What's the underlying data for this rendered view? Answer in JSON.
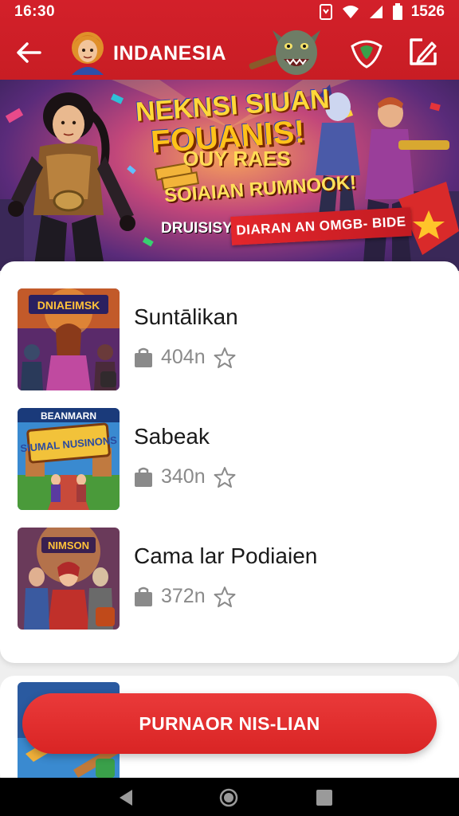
{
  "status_bar": {
    "time": "16:30",
    "battery": "1526"
  },
  "app_bar": {
    "title": "INDANESIA",
    "icons": [
      "arrow-left-icon",
      "avatar",
      "mascot",
      "shield-icon",
      "edit-icon"
    ]
  },
  "banner": {
    "line1": "NEKNSI SIUAN",
    "line2": "FOUANIS!",
    "line3": "OUY RAES",
    "line4": "SOIAIAN RUMNOOK!",
    "line5": "DRUISISY",
    "ribbon": "DIARAN AN OMGB- BIDE"
  },
  "list": {
    "items": [
      {
        "title": "Suntālikan",
        "meta": "404n",
        "thumb_text": "DNIAEIMSK"
      },
      {
        "title": "Sabeak",
        "meta": "340n",
        "thumb_text": "BEANMARN",
        "thumb_text2": "SIUMAL NUSINONS"
      },
      {
        "title": "Cama lar Podiaien",
        "meta": "372n",
        "thumb_text": "NIMSON"
      }
    ]
  },
  "cta": {
    "label": "PURNAOR NIS-LIAN"
  },
  "colors": {
    "primary_red": "#d3202a",
    "cta_red": "#e23030",
    "card_bg": "#ffffff",
    "meta_gray": "#8a8a8a"
  }
}
